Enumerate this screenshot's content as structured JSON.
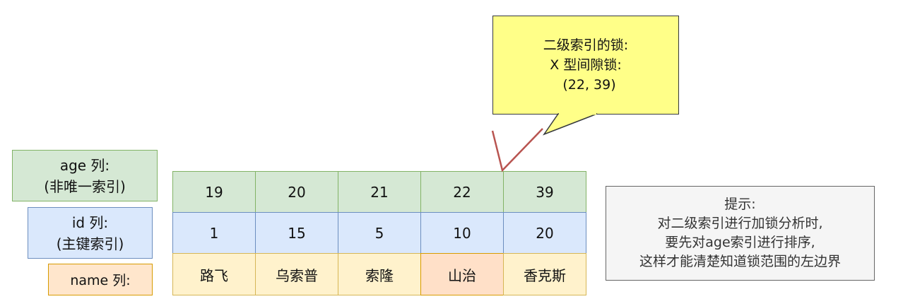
{
  "labels": {
    "age": [
      "age 列:",
      "(非唯一索引)"
    ],
    "id": [
      "id 列:",
      "(主键索引)"
    ],
    "name": "name 列:"
  },
  "table": {
    "age": [
      "19",
      "20",
      "21",
      "22",
      "39"
    ],
    "id": [
      "1",
      "15",
      "5",
      "10",
      "20"
    ],
    "name": [
      "路飞",
      "乌索普",
      "索隆",
      "山治",
      "香克斯"
    ],
    "highlighted_name_index": 3
  },
  "callout": {
    "lines": [
      "二级索引的锁:",
      "X 型间隙锁:",
      "(22, 39)"
    ]
  },
  "tip": {
    "lines": [
      "提示:",
      "对二级索引进行加锁分析时,",
      "要先对age索引进行排序,",
      "这样才能清楚知道锁范围的左边界"
    ]
  },
  "colors": {
    "age_fill": "#d5e8d4",
    "id_fill": "#dae8fc",
    "name_fill": "#fff2cc",
    "highlight_fill": "#ffe0c8",
    "callout_fill": "#ffff88",
    "lock_line": "#b85450"
  }
}
